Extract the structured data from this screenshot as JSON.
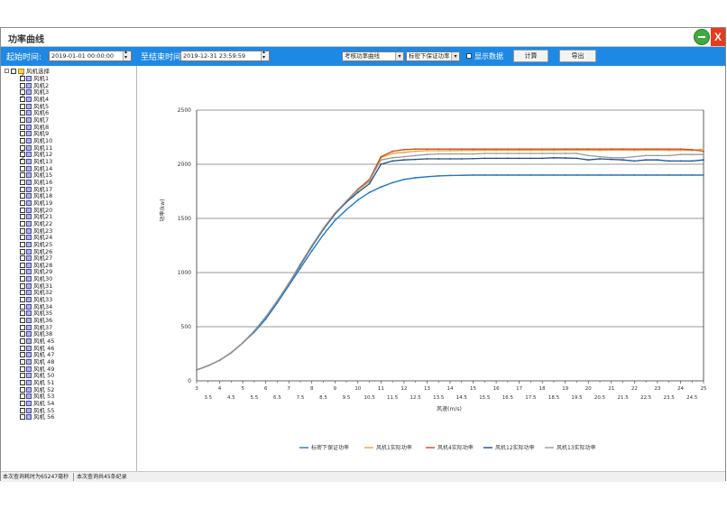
{
  "window": {
    "title": "功率曲线",
    "close_label": "X"
  },
  "toolbar": {
    "start_label": "起始时间:",
    "start_value": "2019-01-01 00:00:00",
    "end_label": "至结束时间",
    "end_value": "2019-12-31 23:59:59",
    "curve_type": "考核功率曲线",
    "density_type": "标密下保证功率",
    "show_data_label": "显示数据",
    "show_data_checked": false,
    "calc_button": "计算",
    "export_button": "导出"
  },
  "tree": {
    "root_label": "风机选择",
    "items": [
      {
        "label": "风机1",
        "checked": true
      },
      {
        "label": "风机2",
        "checked": false
      },
      {
        "label": "风机3",
        "checked": false
      },
      {
        "label": "风机4",
        "checked": true
      },
      {
        "label": "风机5",
        "checked": false
      },
      {
        "label": "风机6",
        "checked": false
      },
      {
        "label": "风机7",
        "checked": false
      },
      {
        "label": "风机8",
        "checked": false
      },
      {
        "label": "风机9",
        "checked": false
      },
      {
        "label": "风机10",
        "checked": false
      },
      {
        "label": "风机11",
        "checked": false
      },
      {
        "label": "风机12",
        "checked": true
      },
      {
        "label": "风机13",
        "checked": true
      },
      {
        "label": "风机14",
        "checked": false
      },
      {
        "label": "风机15",
        "checked": false
      },
      {
        "label": "风机16",
        "checked": false
      },
      {
        "label": "风机17",
        "checked": false
      },
      {
        "label": "风机18",
        "checked": false
      },
      {
        "label": "风机19",
        "checked": false
      },
      {
        "label": "风机20",
        "checked": false
      },
      {
        "label": "风机21",
        "checked": false
      },
      {
        "label": "风机22",
        "checked": false
      },
      {
        "label": "风机23",
        "checked": false
      },
      {
        "label": "风机24",
        "checked": false
      },
      {
        "label": "风机25",
        "checked": false
      },
      {
        "label": "风机26",
        "checked": false
      },
      {
        "label": "风机27",
        "checked": false
      },
      {
        "label": "风机28",
        "checked": false
      },
      {
        "label": "风机29",
        "checked": false
      },
      {
        "label": "风机30",
        "checked": false
      },
      {
        "label": "风机31",
        "checked": false
      },
      {
        "label": "风机32",
        "checked": false
      },
      {
        "label": "风机33",
        "checked": false
      },
      {
        "label": "风机34",
        "checked": false
      },
      {
        "label": "风机35",
        "checked": false
      },
      {
        "label": "风机36",
        "checked": false
      },
      {
        "label": "风机37",
        "checked": false
      },
      {
        "label": "风机38",
        "checked": false
      },
      {
        "label": "风机 45",
        "checked": false
      },
      {
        "label": "风机 46",
        "checked": false
      },
      {
        "label": "风机 47",
        "checked": false
      },
      {
        "label": "风机 48",
        "checked": false
      },
      {
        "label": "风机 49",
        "checked": false
      },
      {
        "label": "风机 50",
        "checked": false
      },
      {
        "label": "风机 51",
        "checked": false
      },
      {
        "label": "风机 52",
        "checked": false
      },
      {
        "label": "风机 53",
        "checked": false
      },
      {
        "label": "风机 54",
        "checked": false
      },
      {
        "label": "风机 55",
        "checked": false
      },
      {
        "label": "风机 56",
        "checked": false
      }
    ]
  },
  "status": {
    "query_time": "本次查询耗时为65247毫秒",
    "record_count": "本次查询共45条纪录"
  },
  "chart_data": {
    "type": "line",
    "xlabel": "风速(m/s)",
    "ylabel": "功率(kw)",
    "xlim": [
      3,
      25
    ],
    "ylim": [
      0,
      2500
    ],
    "yticks": [
      "0",
      "500",
      "1000",
      "1500",
      "2000",
      "2500"
    ],
    "xticks_top": [
      "3",
      "4",
      "5",
      "6",
      "7",
      "8",
      "9",
      "10",
      "11",
      "12",
      "13",
      "14",
      "15",
      "16",
      "17",
      "18",
      "19",
      "20",
      "21",
      "22",
      "23",
      "24",
      "25"
    ],
    "xticks_bottom": [
      "3.5",
      "4.5",
      "5.5",
      "6.5",
      "7.5",
      "8.5",
      "9.5",
      "10.5",
      "11.5",
      "12.5",
      "13.5",
      "14.5",
      "15.5",
      "16.5",
      "17.5",
      "18.5",
      "19.5",
      "20.5",
      "21.5",
      "22.5",
      "23.5",
      "24.5"
    ],
    "grid": true,
    "legend_position": "bottom",
    "x": [
      3,
      3.5,
      4,
      4.5,
      5,
      5.5,
      6,
      6.5,
      7,
      7.5,
      8,
      8.5,
      9,
      9.5,
      10,
      10.5,
      11,
      11.5,
      12,
      12.5,
      13,
      13.5,
      14,
      14.5,
      15,
      15.5,
      16,
      16.5,
      17,
      17.5,
      18,
      18.5,
      19,
      19.5,
      20,
      20.5,
      21,
      21.5,
      22,
      22.5,
      23,
      23.5,
      24,
      24.5,
      25
    ],
    "series": [
      {
        "name": "标密下保证功率",
        "color": "#1f77c8",
        "values": [
          100,
          140,
          190,
          260,
          350,
          450,
          570,
          720,
          880,
          1040,
          1200,
          1350,
          1480,
          1580,
          1670,
          1740,
          1790,
          1830,
          1860,
          1875,
          1885,
          1892,
          1896,
          1898,
          1900,
          1900,
          1900,
          1900,
          1900,
          1900,
          1900,
          1900,
          1900,
          1900,
          1900,
          1900,
          1900,
          1900,
          1900,
          1900,
          1900,
          1900,
          1900,
          1900,
          1900
        ]
      },
      {
        "name": "风机1实际功率",
        "color": "#f0a030",
        "values": [
          100,
          140,
          190,
          260,
          350,
          460,
          590,
          740,
          900,
          1070,
          1240,
          1400,
          1540,
          1660,
          1760,
          1840,
          2060,
          2100,
          2110,
          2120,
          2125,
          2125,
          2125,
          2127,
          2128,
          2128,
          2128,
          2128,
          2128,
          2128,
          2128,
          2128,
          2130,
          2130,
          2130,
          2128,
          2130,
          2130,
          2128,
          2130,
          2130,
          2128,
          2128,
          2128,
          2140
        ]
      },
      {
        "name": "风机4实际功率",
        "color": "#d04a1a",
        "values": [
          100,
          140,
          190,
          260,
          350,
          460,
          590,
          740,
          900,
          1070,
          1240,
          1400,
          1540,
          1660,
          1770,
          1860,
          2070,
          2120,
          2135,
          2140,
          2140,
          2140,
          2140,
          2140,
          2140,
          2140,
          2140,
          2140,
          2140,
          2140,
          2140,
          2140,
          2140,
          2140,
          2140,
          2140,
          2140,
          2140,
          2140,
          2140,
          2140,
          2140,
          2140,
          2135,
          2120
        ]
      },
      {
        "name": "风机12实际功率",
        "color": "#1a4f8c",
        "values": [
          100,
          140,
          190,
          260,
          350,
          460,
          590,
          740,
          900,
          1070,
          1240,
          1400,
          1540,
          1650,
          1740,
          1820,
          2000,
          2030,
          2040,
          2045,
          2050,
          2050,
          2050,
          2050,
          2052,
          2055,
          2055,
          2055,
          2055,
          2055,
          2055,
          2060,
          2058,
          2055,
          2040,
          2050,
          2045,
          2040,
          2030,
          2040,
          2040,
          2030,
          2030,
          2030,
          2040
        ]
      },
      {
        "name": "风机13实际功率",
        "color": "#999999",
        "values": [
          100,
          140,
          190,
          260,
          350,
          460,
          590,
          740,
          900,
          1080,
          1250,
          1410,
          1550,
          1660,
          1760,
          1850,
          2040,
          2060,
          2070,
          2080,
          2090,
          2095,
          2095,
          2095,
          2095,
          2100,
          2100,
          2100,
          2100,
          2100,
          2100,
          2100,
          2100,
          2100,
          2080,
          2070,
          2060,
          2060,
          2070,
          2080,
          2080,
          2080,
          2090,
          2090,
          2090
        ]
      }
    ]
  }
}
